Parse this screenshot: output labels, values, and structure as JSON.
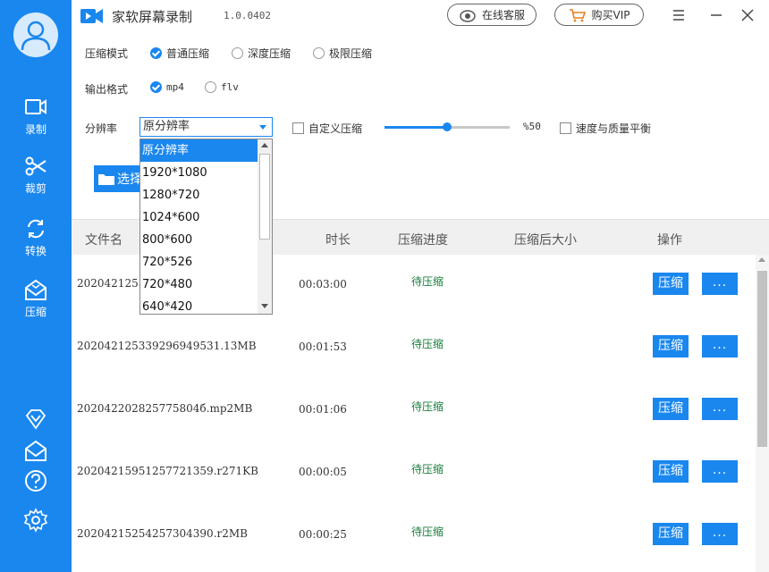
{
  "app": {
    "title": "家软屏幕录制",
    "version": "1.0.0402",
    "online_service": "在线客服",
    "buy_vip": "购买VIP"
  },
  "sidebar": {
    "items": [
      {
        "label": "录制",
        "icon": "video-camera-icon"
      },
      {
        "label": "裁剪",
        "icon": "scissors-icon"
      },
      {
        "label": "转换",
        "icon": "refresh-icon"
      },
      {
        "label": "压缩",
        "icon": "compress-envelope-icon"
      }
    ]
  },
  "settings": {
    "mode_label": "压缩模式",
    "modes": [
      "普通压缩",
      "深度压缩",
      "极限压缩"
    ],
    "format_label": "输出格式",
    "formats": [
      "mp4",
      "flv"
    ],
    "resolution_label": "分辨率",
    "resolution_selected": "原分辨率",
    "resolution_options": [
      "原分辨率",
      "1920*1080",
      "1280*720",
      "1024*600",
      "800*600",
      "720*526",
      "720*480",
      "640*420"
    ],
    "custom_compress": "自定义压缩",
    "slider_value": "%50",
    "slider_level": 0.5,
    "speed_quality": "速度与质量平衡",
    "choose_button": "选择"
  },
  "table": {
    "headers": [
      "文件名",
      "时长",
      "压缩进度",
      "压缩后大小",
      "操作"
    ],
    "rows": [
      {
        "name": "2020421255",
        "duration": "00:03:00",
        "status": "待压缩",
        "size": ""
      },
      {
        "name": "202042125339296949531.13MB",
        "duration": "00:01:53",
        "status": "待压缩",
        "size": ""
      },
      {
        "name": "202042202825775804б.mp2MB",
        "duration": "00:01:06",
        "status": "待压缩",
        "size": ""
      },
      {
        "name": "20204215951257721359.r271KB",
        "duration": "00:00:05",
        "status": "待压缩",
        "size": ""
      },
      {
        "name": "20204215254257304390.r2MB",
        "duration": "00:00:25",
        "status": "待压缩",
        "size": ""
      }
    ],
    "compress_label": "压缩",
    "more_label": "..."
  },
  "colors": {
    "accent": "#1a87ef",
    "status": "#1a7d3c"
  }
}
